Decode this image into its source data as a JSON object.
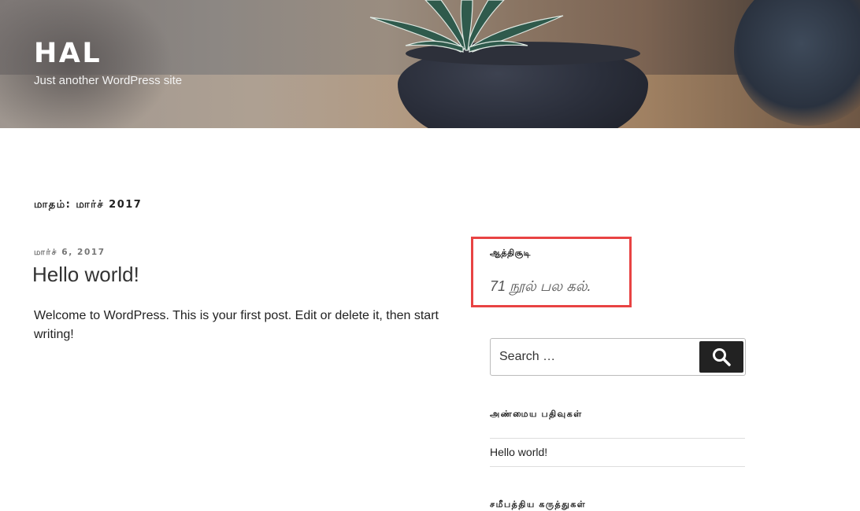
{
  "header": {
    "site_title": "HAL",
    "site_description": "Just another WordPress site"
  },
  "archive": {
    "title": "மாதம்: மார்ச் 2017"
  },
  "post": {
    "date": "மார்ச் 6, 2017",
    "title": "Hello world!",
    "excerpt": "Welcome to WordPress. This is your first post. Edit or delete it, then start writing!"
  },
  "sidebar": {
    "text_widget": {
      "title": "ஆத்திசூடி",
      "text": "71 நூல் பல கல்."
    },
    "search": {
      "placeholder": "Search …",
      "icon": "search-icon"
    },
    "recent_posts": {
      "title": "அண்மைய பதிவுகள்",
      "items": [
        {
          "label": "Hello world!"
        }
      ]
    },
    "next_widget_title": "சமீபத்திய கருத்துகள்"
  },
  "colors": {
    "highlight_border": "#e84343",
    "search_button": "#222222",
    "text": "#222222",
    "meta": "#767676"
  }
}
